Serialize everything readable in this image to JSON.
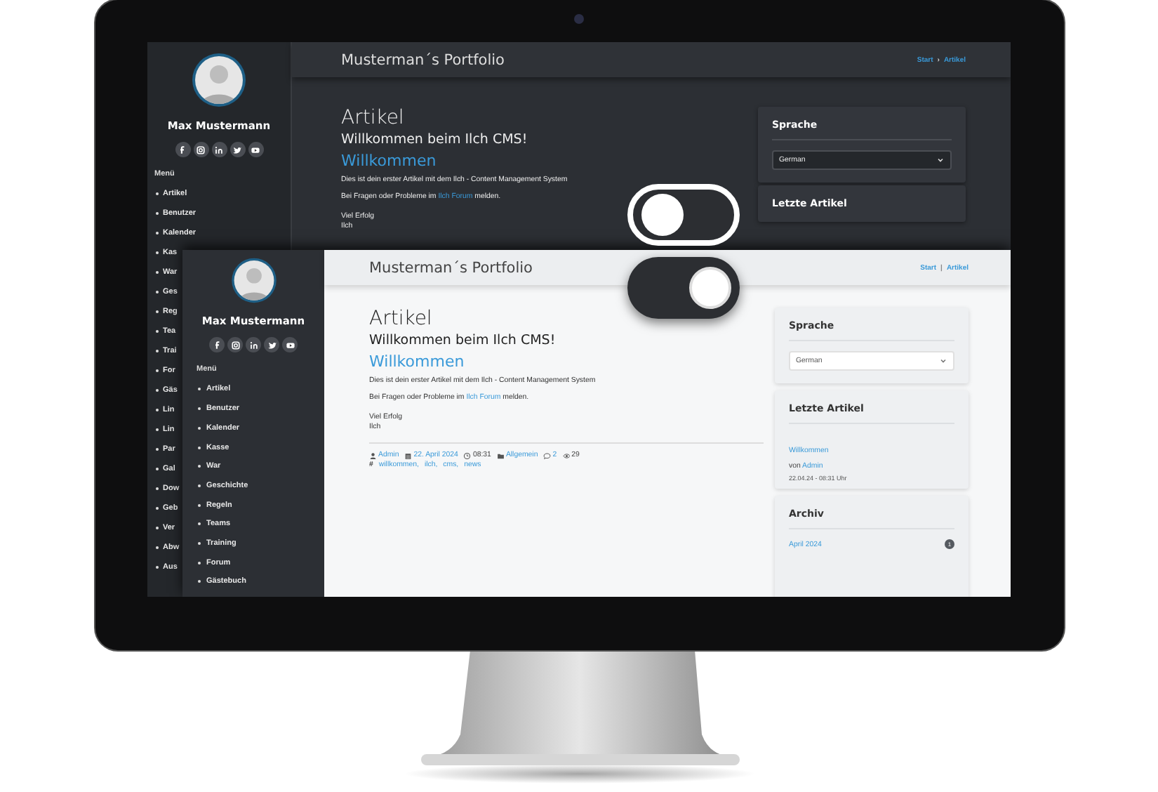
{
  "dark_site": {
    "profile_name": "Max Mustermann",
    "social": [
      {
        "kind": "facebook"
      },
      {
        "kind": "instagram"
      },
      {
        "kind": "linkedin"
      },
      {
        "kind": "twitter"
      },
      {
        "kind": "youtube"
      }
    ],
    "menu_title": "Menü",
    "menu": [
      "Artikel",
      "Benutzer",
      "Kalender",
      "Kas",
      "War",
      "Ges",
      "Reg",
      "Tea",
      "Trai",
      "For",
      "Gäs",
      "Lin",
      "Lin",
      "Par",
      "Gal",
      "Dow",
      "Geb",
      "Ver",
      "Abw",
      "Aus"
    ],
    "header_title": "Musterman´s Portfolio",
    "breadcrumb": {
      "items": [
        "Start",
        "Artikel"
      ],
      "separator": "›"
    },
    "article": {
      "heading": "Artikel",
      "title": "Willkommen beim Ilch CMS!",
      "subtitle": "Willkommen",
      "intro": "Dies ist dein erster Artikel mit dem Ilch - Content Management System",
      "question": {
        "before": "Bei Fragen oder Probleme im ",
        "link": "Ilch Forum",
        "after": " melden."
      },
      "signature": [
        "Viel Erfolg",
        "Ilch"
      ]
    },
    "widgets": [
      {
        "kind": "select",
        "title": "Sprache",
        "value": "German"
      },
      {
        "kind": "heading",
        "title": "Letzte Artikel"
      }
    ]
  },
  "light_site": {
    "profile_name": "Max Mustermann",
    "social": [
      {
        "kind": "facebook"
      },
      {
        "kind": "instagram"
      },
      {
        "kind": "linkedin"
      },
      {
        "kind": "twitter"
      },
      {
        "kind": "youtube"
      }
    ],
    "menu_title": "Menü",
    "menu": [
      "Artikel",
      "Benutzer",
      "Kalender",
      "Kasse",
      "War",
      "Geschichte",
      "Regeln",
      "Teams",
      "Training",
      "Forum",
      "Gästebuch"
    ],
    "header_title": "Musterman´s Portfolio",
    "breadcrumb": {
      "items": [
        "Start",
        "Artikel"
      ],
      "separator": "|"
    },
    "article": {
      "heading": "Artikel",
      "title": "Willkommen beim Ilch CMS!",
      "subtitle": "Willkommen",
      "intro": "Dies ist dein erster Artikel mit dem Ilch - Content Management System",
      "question": {
        "before": "Bei Fragen oder Probleme im ",
        "link": "Ilch Forum",
        "after": " melden."
      },
      "signature": [
        "Viel Erfolg",
        "Ilch"
      ],
      "meta": [
        {
          "kind": "user",
          "text": "Admin",
          "link": true
        },
        {
          "kind": "calendar",
          "text": "22. April 2024",
          "link": true
        },
        {
          "kind": "clock",
          "text": "08:31",
          "link": false
        },
        {
          "kind": "folder",
          "text": "Allgemein",
          "link": true
        },
        {
          "kind": "comment",
          "text": "2",
          "link": true
        },
        {
          "kind": "eye",
          "text": "29",
          "link": false
        }
      ],
      "tag_mark": "#",
      "tags": [
        "willkommen,",
        "ilch,",
        "cms,",
        "news"
      ]
    },
    "widgets": [
      {
        "kind": "select",
        "title": "Sprache",
        "value": "German"
      },
      {
        "kind": "recent",
        "title": "Letzte Artikel",
        "link": "Willkommen",
        "by": "von",
        "author": "Admin",
        "date": "22.04.24 - 08:31 Uhr"
      },
      {
        "kind": "archive",
        "title": "Archiv",
        "link": "April 2024",
        "count": "1"
      }
    ]
  },
  "toggles": [
    {
      "on": false
    },
    {
      "on": true
    }
  ]
}
